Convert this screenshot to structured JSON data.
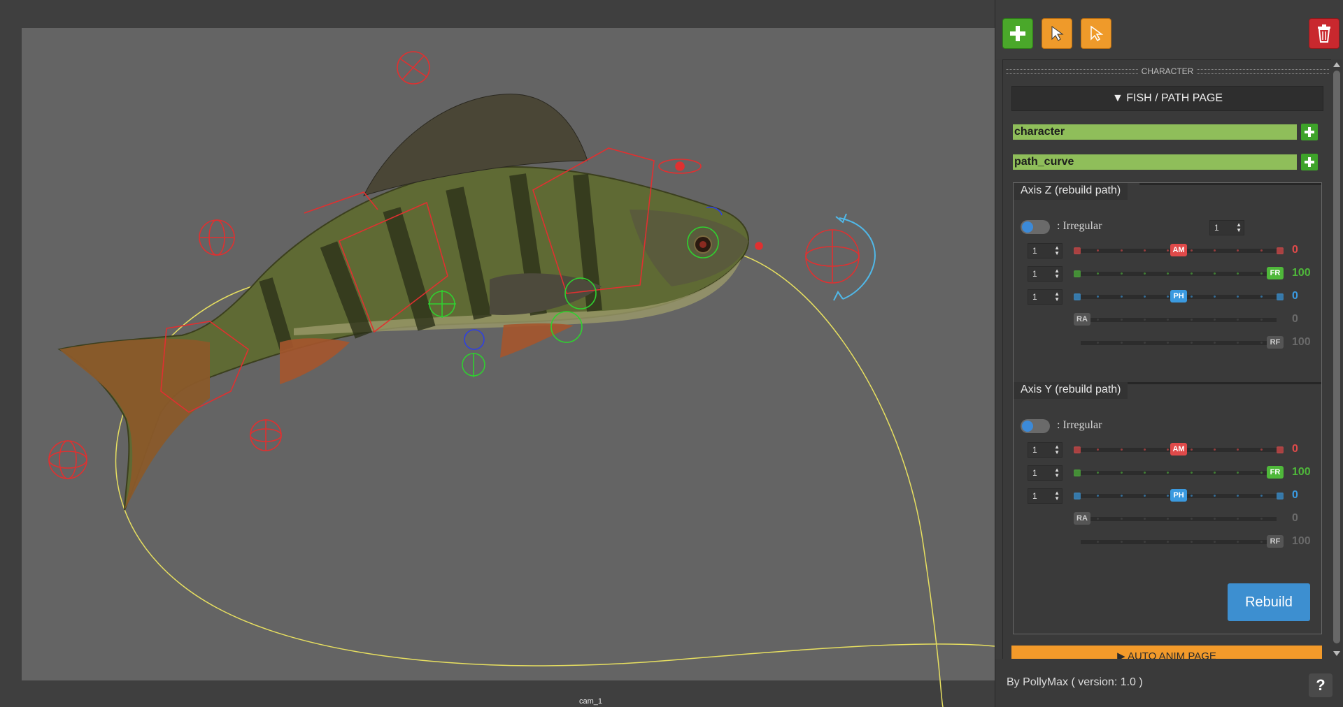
{
  "viewport": {
    "camera_label": "cam_1"
  },
  "panel": {
    "toolbar": {
      "add_icon": "plus-icon",
      "select_icon": "cursor-icon",
      "select_alt_icon": "cursor-outline-icon",
      "delete_icon": "trash-icon"
    },
    "section_header": "CHARACTER",
    "fish_page_button": "▼ FISH / PATH PAGE",
    "character_field": "character",
    "path_field": "path_curve",
    "axis_z": {
      "title": "Axis Z (rebuild path)",
      "irregular_label": ": Irregular",
      "irregular_spin": "1",
      "sliders": [
        {
          "spin": "1",
          "handle": "AM",
          "value": "0",
          "color": "#e04a4a",
          "fraction": 0.5
        },
        {
          "spin": "1",
          "handle": "FR",
          "value": "100",
          "color": "#4fb83a",
          "fraction": 1.0
        },
        {
          "spin": "1",
          "handle": "PH",
          "value": "0",
          "color": "#3b9ae0",
          "fraction": 0.5
        },
        {
          "spin": "",
          "handle": "RA",
          "value": "0",
          "color": "#777777",
          "fraction": 0.0
        },
        {
          "spin": "",
          "handle": "RF",
          "value": "100",
          "color": "#777777",
          "fraction": 1.0
        }
      ]
    },
    "axis_y": {
      "title": "Axis Y (rebuild path)",
      "irregular_label": ": Irregular",
      "sliders": [
        {
          "spin": "1",
          "handle": "AM",
          "value": "0",
          "color": "#e04a4a",
          "fraction": 0.5
        },
        {
          "spin": "1",
          "handle": "FR",
          "value": "100",
          "color": "#4fb83a",
          "fraction": 1.0
        },
        {
          "spin": "1",
          "handle": "PH",
          "value": "0",
          "color": "#3b9ae0",
          "fraction": 0.5
        },
        {
          "spin": "",
          "handle": "RA",
          "value": "0",
          "color": "#777777",
          "fraction": 0.0
        },
        {
          "spin": "",
          "handle": "RF",
          "value": "100",
          "color": "#777777",
          "fraction": 1.0
        }
      ]
    },
    "rebuild_button": "Rebuild",
    "auto_anim_button": "▶ AUTO ANIM PAGE",
    "footer_credit": "By PollyMax ( version: 1.0 )",
    "help_label": "?"
  }
}
